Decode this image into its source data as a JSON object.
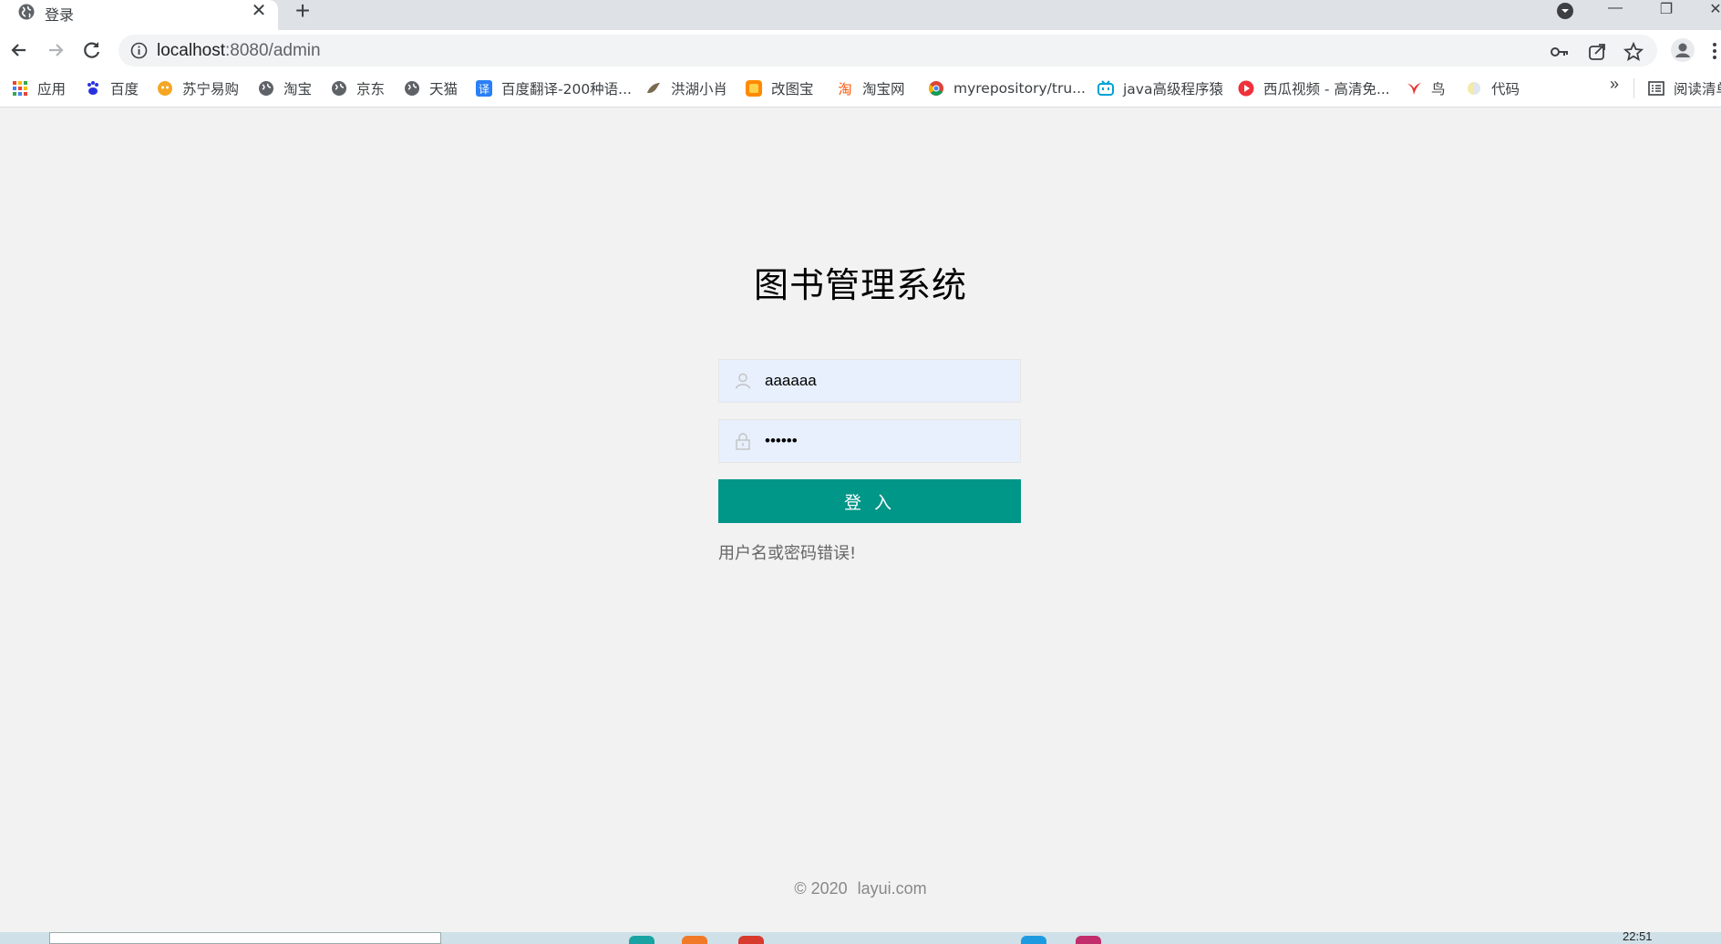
{
  "browser": {
    "tab": {
      "title": "登录",
      "close": "✕"
    },
    "new_tab": "+",
    "window_controls": {
      "minimize": "—",
      "maximize": "❐",
      "close": "✕"
    },
    "url": {
      "host": "localhost",
      "rest": ":8080/admin"
    }
  },
  "bookmarks": [
    {
      "label": "应用",
      "icon": "apps-grid-icon"
    },
    {
      "label": "百度",
      "icon": "baidu-paw-icon"
    },
    {
      "label": "苏宁易购",
      "icon": "suning-icon"
    },
    {
      "label": "淘宝",
      "icon": "globe-icon"
    },
    {
      "label": "京东",
      "icon": "globe-icon"
    },
    {
      "label": "天猫",
      "icon": "globe-icon"
    },
    {
      "label": "百度翻译-200种语...",
      "icon": "baidu-translate-icon"
    },
    {
      "label": "洪湖小肖",
      "icon": "bird-icon"
    },
    {
      "label": "改图宝",
      "icon": "gaitubao-icon"
    },
    {
      "label": "淘宝网",
      "icon": "taobao-icon"
    },
    {
      "label": "myrepository/tru...",
      "icon": "chrome-icon"
    },
    {
      "label": "java高级程序猿",
      "icon": "bilibili-icon"
    },
    {
      "label": "西瓜视频 - 高清免...",
      "icon": "xigua-icon"
    },
    {
      "label": "鸟",
      "icon": "bird-red-icon"
    },
    {
      "label": "代码",
      "icon": "code-icon"
    }
  ],
  "bookmarks_more": "»",
  "reading_list": "阅读清单",
  "login": {
    "title": "图书管理系统",
    "username_value": "aaaaaa",
    "password_value": "aaaaaa",
    "submit_label": "登 入",
    "error_message": "用户名或密码错误!"
  },
  "footer": {
    "copyright": "© 2020",
    "site": "layui.com"
  },
  "taskbar": {
    "clock": "22:51"
  },
  "colors": {
    "primary": "#009688",
    "page_bg": "#f2f2f2",
    "input_autofill_bg": "#e8f0fe"
  }
}
